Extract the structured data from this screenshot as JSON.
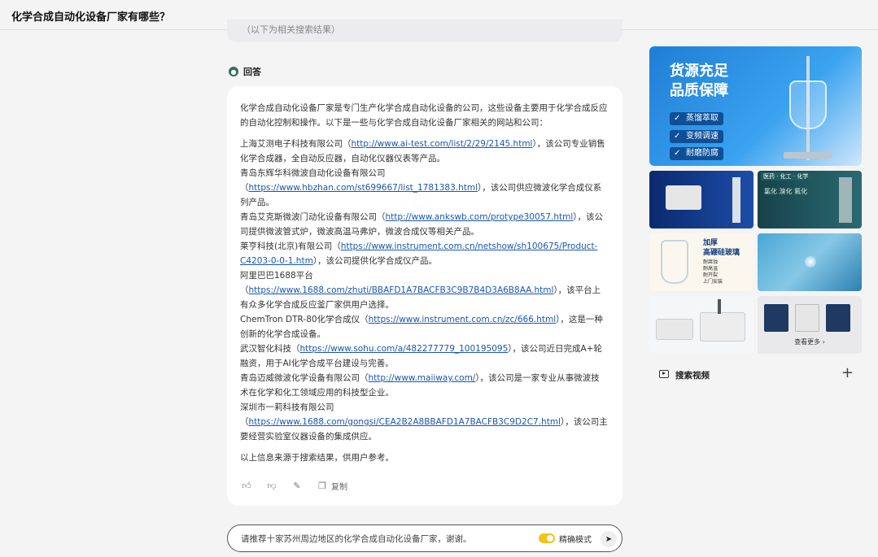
{
  "header": {
    "title": "化学合成自动化设备厂家有哪些？"
  },
  "previous": {
    "text": "（以下为相关搜索结果）"
  },
  "answer": {
    "label": "回答",
    "intro": "化学合成自动化设备厂家是专门生产化学合成自动化设备的公司，这些设备主要用于化学合成反应的自动化控制和操作。以下是一些与化学合成自动化设备厂家相关的网站和公司：",
    "items": [
      {
        "prefix": "上海艾测电子科技有限公司（",
        "link": "http://www.ai-test.com/list/2/29/2145.html",
        "suffix": "），该公司专业销售化学合成器，全自动反应器，自动化仪器仪表等产品。"
      },
      {
        "prefix": "青岛东辉华科微波自动化设备有限公司（",
        "link": "https://www.hbzhan.com/st699667/list_1781383.html",
        "suffix": "），该公司供应微波化学合成仪系列产品。"
      },
      {
        "prefix": "青岛艾克斯微波门动化设备有限公司（",
        "link": "http://www.ankswb.com/protype30057.html",
        "suffix": "），该公司提供微波管式炉，微波高温马弗炉，微波合成仪等相关产品。"
      },
      {
        "prefix": "莱亨科技(北京)有限公司（",
        "link": "https://www.instrument.com.cn/netshow/sh100675/Product-C4203-0-0-1.htm",
        "suffix": "），该公司提供化学合成仪产品。"
      },
      {
        "prefix": "阿里巴巴1688平台（",
        "link": "https://www.1688.com/zhuti/BBAFD1A7BACFB3C9B7B4D3A6B8AA.html",
        "suffix": "），该平台上有众多化学合成反应釜厂家供用户选择。"
      },
      {
        "prefix": "ChemTron DTR-80化学合成仪（",
        "link": "https://www.instrument.com.cn/zc/666.html",
        "suffix": "），这是一种创新的化学合成设备。"
      },
      {
        "prefix": "武汉智化科技（",
        "link": "https://www.sohu.com/a/482277779_100195095",
        "suffix": "），该公司近日完成A+轮融资，用于AI化学合成平台建设与完善。"
      },
      {
        "prefix": "青岛迈威微波化学设备有限公司（",
        "link": "http://www.maiiway.com/",
        "suffix": "），该公司是一家专业从事微波技术在化学和化工领域应用的科技型企业。"
      },
      {
        "prefix": "深圳市一莉科技有限公司（",
        "link": "https://www.1688.com/gongsi/CEA2B2A8BBAFD1A7BACFB3C9D2C7.html",
        "suffix": "），该公司主要经营实验室仪器设备的集成供应。"
      }
    ],
    "outro": "以上信息来源于搜索结果，供用户参考。",
    "actions": {
      "copy_label": "复制"
    }
  },
  "input": {
    "placeholder": "请推荐十家苏州周边地区的化学合成自动化设备厂家，谢谢。",
    "mode_label": "精确模式",
    "mode_on": true
  },
  "sidebar": {
    "ad": {
      "line1": "货源充足",
      "line2": "品质保障",
      "badges": [
        "蒸馏萃取",
        "变频调速",
        "耐磨防腐"
      ]
    },
    "thumbs": {
      "t2_tag": "医药 · 化工 · 化学",
      "t2_row": "氯化  溴化  氟化",
      "t3_head": "加厚",
      "t3_sub": "高硼硅玻璃",
      "t3_lines": [
        "耐腐蚀",
        "耐高温",
        "耐开裂",
        "上门安装"
      ],
      "more_label": "查看更多 ›"
    },
    "video": {
      "label": "搜索视频"
    }
  },
  "colors": {
    "accent": "#2f6f5e",
    "link": "#1a56b0",
    "toggle": "#f0c419"
  }
}
